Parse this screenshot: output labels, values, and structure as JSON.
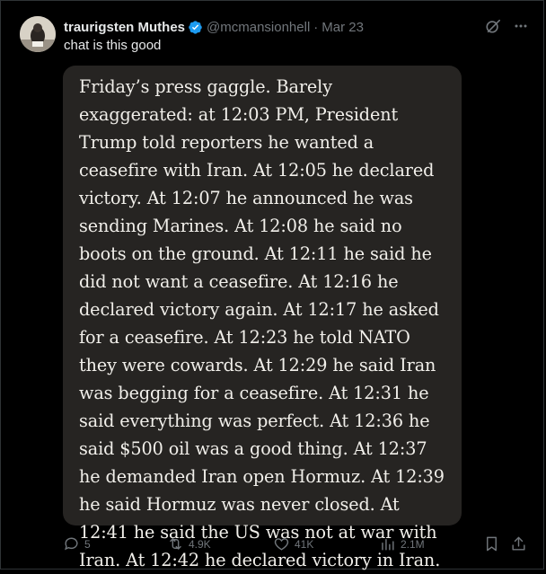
{
  "post": {
    "author_name": "traurigsten Muthes",
    "handle": "@mcmansionhell",
    "separator": "·",
    "date": "Mar 23",
    "text": "chat is this good"
  },
  "quote": {
    "text": "Friday’s press gaggle. Barely exaggerated: at 12:03 PM, President Trump told reporters he wanted a ceasefire with Iran. At 12:05 he declared victory. At 12:07 he announced he was sending Marines. At 12:08 he said no boots on the ground. At 12:11 he said he did not want a ceasefire. At 12:16 he declared victory again. At 12:17 he asked for a ceasefire. At 12:23 he told NATO they were cowards. At 12:29 he said Iran was begging for a ceasefire. At 12:31 he said everything was perfect. At 12:36 he said $500 oil was a good thing. At 12:37 he demanded Iran open Hormuz. At 12:39 he said Hormuz was never closed. At 12:41 he said the US was not at war with Iran. At 12:42 he declared victory in Iran."
  },
  "actions": {
    "replies": "5",
    "reposts": "4.9K",
    "likes": "41K",
    "views": "2.1M"
  },
  "icons": {
    "verified": "verified-badge-icon",
    "grok": "grok-icon",
    "more": "more-icon",
    "reply": "reply-icon",
    "repost": "repost-icon",
    "like": "heart-icon",
    "views": "views-icon",
    "bookmark": "bookmark-icon",
    "share": "share-icon"
  },
  "colors": {
    "background": "#000000",
    "quote_background": "#262422",
    "verified": "#1d9bf0",
    "muted": "#71767b"
  }
}
